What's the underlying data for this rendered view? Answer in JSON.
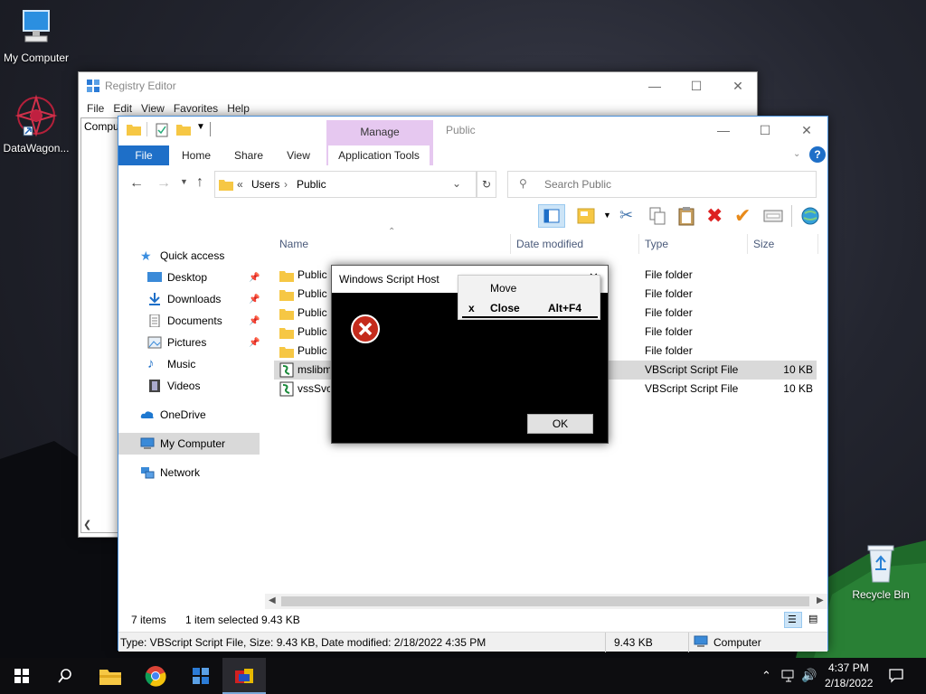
{
  "desktop": {
    "icons": [
      {
        "label": "My Computer",
        "icon": "computer-icon"
      },
      {
        "label": "DataWagon...",
        "icon": "datawagon-icon"
      },
      {
        "label": "Recycle Bin",
        "icon": "recycle-bin-icon"
      }
    ]
  },
  "registry": {
    "title": "Registry Editor",
    "menu": [
      "File",
      "Edit",
      "View",
      "Favorites",
      "Help"
    ],
    "tree_label": "Compu"
  },
  "explorer": {
    "title": "Public",
    "manage_label": "Manage",
    "tabs": [
      "File",
      "Home",
      "Share",
      "View",
      "Application Tools"
    ],
    "address": {
      "prefix": "«",
      "parts": [
        "Users",
        "Public"
      ]
    },
    "search_placeholder": "Search Public",
    "nav": {
      "quick_access": "Quick access",
      "items": [
        {
          "label": "Desktop",
          "pinned": true
        },
        {
          "label": "Downloads",
          "pinned": true
        },
        {
          "label": "Documents",
          "pinned": true
        },
        {
          "label": "Pictures",
          "pinned": true
        },
        {
          "label": "Music",
          "pinned": false
        },
        {
          "label": "Videos",
          "pinned": false
        }
      ],
      "onedrive": "OneDrive",
      "my_computer": "My Computer",
      "network": "Network"
    },
    "columns": [
      "Name",
      "Date modified",
      "Type",
      "Size"
    ],
    "files": [
      {
        "name": "Public D",
        "date": "",
        "type": "File folder",
        "size": "",
        "kind": "folder"
      },
      {
        "name": "Public",
        "date": "",
        "type": "File folder",
        "size": "",
        "kind": "folder"
      },
      {
        "name": "Public",
        "date": "",
        "type": "File folder",
        "size": "",
        "kind": "folder"
      },
      {
        "name": "Public",
        "date": "",
        "type": "File folder",
        "size": "",
        "kind": "folder"
      },
      {
        "name": "Public V",
        "date": "",
        "type": "File folder",
        "size": "",
        "kind": "folder"
      },
      {
        "name": "mslibm",
        "date": "",
        "type": "VBScript Script File",
        "size": "10 KB",
        "kind": "script",
        "selected": true
      },
      {
        "name": "vssSvc.",
        "date": "",
        "type": "VBScript Script File",
        "size": "10 KB",
        "kind": "script"
      }
    ],
    "status": {
      "items": "7 items",
      "selected": "1 item selected  9.43 KB"
    },
    "details_bar": {
      "info": "Type: VBScript Script File, Size: 9.43 KB, Date modified: 2/18/2022 4:35 PM",
      "size": "9.43 KB",
      "location": "Computer"
    }
  },
  "dialog": {
    "title": "Windows Script Host",
    "ok_label": "OK",
    "context_menu": {
      "move": "Move",
      "close": "Close",
      "close_mark": "x",
      "close_shortcut": "Alt+F4"
    }
  },
  "taskbar": {
    "time": "4:37 PM",
    "date": "2/18/2022"
  },
  "colors": {
    "accent": "#1e6fc8",
    "manage": "#e6c8f0",
    "selection": "#d9d9d9",
    "error": "#c42b1c"
  }
}
